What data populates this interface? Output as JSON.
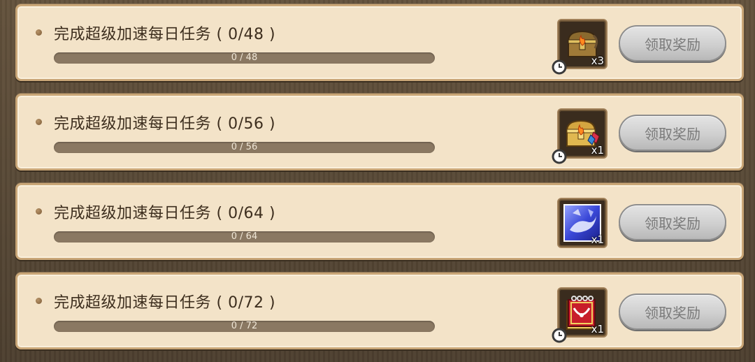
{
  "tasks": [
    {
      "title": "完成超级加速每日任务 ( 0/48 )",
      "progress_text": "0 / 48",
      "progress": {
        "current": 0,
        "total": 48
      },
      "reward": {
        "icon": "treasure-chest-icon",
        "qty": "x3"
      },
      "claim_label": "领取奖励"
    },
    {
      "title": "完成超级加速每日任务 ( 0/56 )",
      "progress_text": "0 / 56",
      "progress": {
        "current": 0,
        "total": 56
      },
      "reward": {
        "icon": "gem-treasure-chest-icon",
        "qty": "x1"
      },
      "claim_label": "领取奖励"
    },
    {
      "title": "完成超级加速每日任务 ( 0/64 )",
      "progress_text": "0 / 64",
      "progress": {
        "current": 0,
        "total": 64
      },
      "reward": {
        "icon": "blue-crystal-card-icon",
        "qty": "x1"
      },
      "claim_label": "领取奖励"
    },
    {
      "title": "完成超级加速每日任务 ( 0/72 )",
      "progress_text": "0 / 72",
      "progress": {
        "current": 0,
        "total": 72
      },
      "reward": {
        "icon": "red-spellbook-icon",
        "qty": "x1"
      },
      "claim_label": "领取奖励"
    }
  ],
  "colors": {
    "card_bg": "#f3e3c8",
    "card_border": "#c9a677",
    "progress_track": "#8a7862",
    "button_disabled": "#cfcfcf"
  }
}
